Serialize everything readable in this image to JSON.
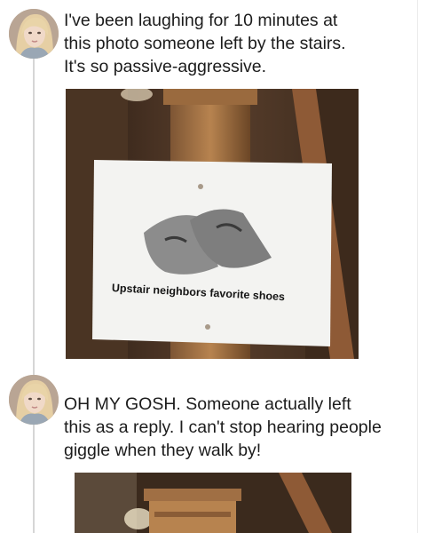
{
  "posts": [
    {
      "text": "I've been laughing for 10 minutes at\nthis photo someone left by the stairs.\nIt's so passive-aggressive.",
      "photo": {
        "sign_text": "Upstair neighbors favorite shoes"
      }
    },
    {
      "text": "OH MY GOSH. Someone actually left\nthis as a reply. I can't stop hearing people\ngiggle when they walk by!"
    }
  ],
  "colors": {
    "thread_line": "#d6d6d6",
    "text": "#1c1c1c",
    "background": "#ffffff"
  }
}
